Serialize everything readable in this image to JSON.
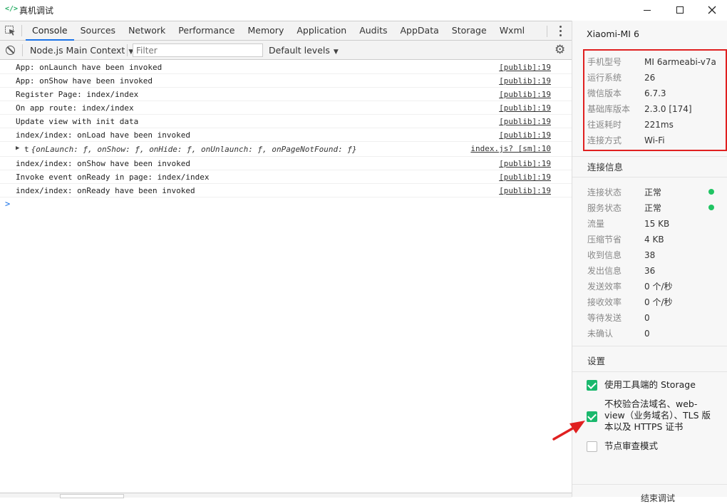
{
  "window": {
    "title": "真机调试",
    "icon_label": "</>"
  },
  "tabs": [
    {
      "label": "Console",
      "active": true
    },
    {
      "label": "Sources"
    },
    {
      "label": "Network"
    },
    {
      "label": "Performance"
    },
    {
      "label": "Memory"
    },
    {
      "label": "Application"
    },
    {
      "label": "Audits"
    },
    {
      "label": "AppData"
    },
    {
      "label": "Storage"
    },
    {
      "label": "Wxml"
    }
  ],
  "toolbar": {
    "context": "Node.js Main Context",
    "filter_placeholder": "Filter",
    "levels": "Default levels"
  },
  "logs": [
    {
      "msg": "App: onLaunch have been invoked",
      "src": "[publib]:19"
    },
    {
      "msg": "App: onShow have been invoked",
      "src": "[publib]:19"
    },
    {
      "msg": "Register Page: index/index",
      "src": "[publib]:19"
    },
    {
      "msg": "On app route: index/index",
      "src": "[publib]:19"
    },
    {
      "msg": "Update view with init data",
      "src": "[publib]:19"
    },
    {
      "msg": "index/index: onLoad have been invoked",
      "src": "[publib]:19"
    }
  ],
  "object_log": {
    "prefix": "t",
    "msg": "{onLaunch: ƒ, onShow: ƒ, onHide: ƒ, onUnlaunch: ƒ, onPageNotFound: ƒ}",
    "src": "index.js? [sm]:10"
  },
  "logs_after": [
    {
      "msg": "index/index: onShow have been invoked",
      "src": "[publib]:19"
    },
    {
      "msg": "Invoke event onReady in page: index/index",
      "src": "[publib]:19"
    },
    {
      "msg": "index/index: onReady have been invoked",
      "src": "[publib]:19"
    }
  ],
  "prompt": ">",
  "panel": {
    "device": "Xiaomi-MI 6",
    "device_info": [
      {
        "k": "手机型号",
        "v": "MI 6armeabi-v7a"
      },
      {
        "k": "运行系统",
        "v": "26"
      },
      {
        "k": "微信版本",
        "v": "6.7.3"
      },
      {
        "k": "基础库版本",
        "v": "2.3.0 [174]"
      },
      {
        "k": "往返耗时",
        "v": "221ms"
      },
      {
        "k": "连接方式",
        "v": "Wi-Fi"
      }
    ],
    "conn_title": "连接信息",
    "conn_info": [
      {
        "k": "连接状态",
        "v": "正常",
        "dot": true
      },
      {
        "k": "服务状态",
        "v": "正常",
        "dot": true
      },
      {
        "k": "流量",
        "v": "15 KB"
      },
      {
        "k": "压缩节省",
        "v": "4 KB"
      },
      {
        "k": "收到信息",
        "v": "38"
      },
      {
        "k": "发出信息",
        "v": "36"
      },
      {
        "k": "发送效率",
        "v": "0 个/秒"
      },
      {
        "k": "接收效率",
        "v": "0 个/秒"
      },
      {
        "k": "等待发送",
        "v": "0"
      },
      {
        "k": "未确认",
        "v": "0"
      }
    ],
    "settings_title": "设置",
    "settings": [
      {
        "label": "使用工具端的 Storage",
        "checked": true
      },
      {
        "label_lines": [
          "不校验合法域名、web-",
          "view（业务域名）、TLS 版",
          "本以及 HTTPS 证书"
        ],
        "checked": true
      },
      {
        "label": "节点审查模式",
        "checked": false
      }
    ],
    "close_label": "结束调试"
  },
  "colors": {
    "accent": "#1a73e8",
    "check_green": "#1ab86d",
    "status_dot": "#20c463",
    "highlight_red": "#e02020"
  }
}
